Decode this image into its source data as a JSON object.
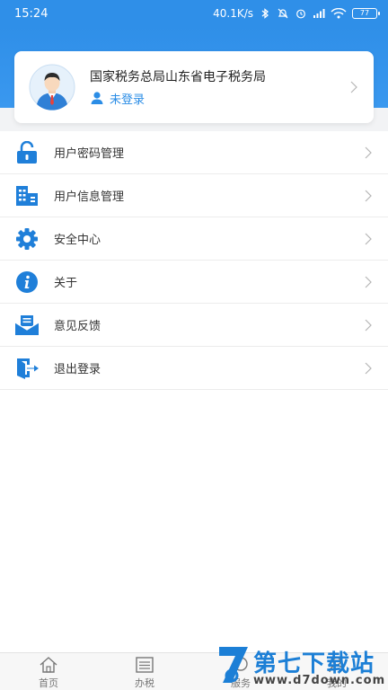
{
  "status_bar": {
    "time": "15:24",
    "speed": "40.1K/s",
    "battery": "77"
  },
  "profile": {
    "org_name": "国家税务总局山东省电子税务局",
    "login_status": "未登录"
  },
  "menu": [
    {
      "label": "用户密码管理",
      "icon": "lock-icon"
    },
    {
      "label": "用户信息管理",
      "icon": "building-icon"
    },
    {
      "label": "安全中心",
      "icon": "gear-icon"
    },
    {
      "label": "关于",
      "icon": "info-icon"
    },
    {
      "label": "意见反馈",
      "icon": "mail-icon"
    },
    {
      "label": "退出登录",
      "icon": "logout-icon"
    }
  ],
  "tabs": [
    {
      "label": "首页",
      "icon": "home-icon"
    },
    {
      "label": "办税",
      "icon": "list-icon"
    },
    {
      "label": "服务",
      "icon": "service-icon"
    },
    {
      "label": "我的",
      "icon": "user-icon"
    }
  ],
  "watermark": {
    "title": "第七下载站",
    "url": "www.d7down.com"
  },
  "colors": {
    "primary": "#2f8fe8",
    "icon_blue": "#1f7fd9"
  }
}
